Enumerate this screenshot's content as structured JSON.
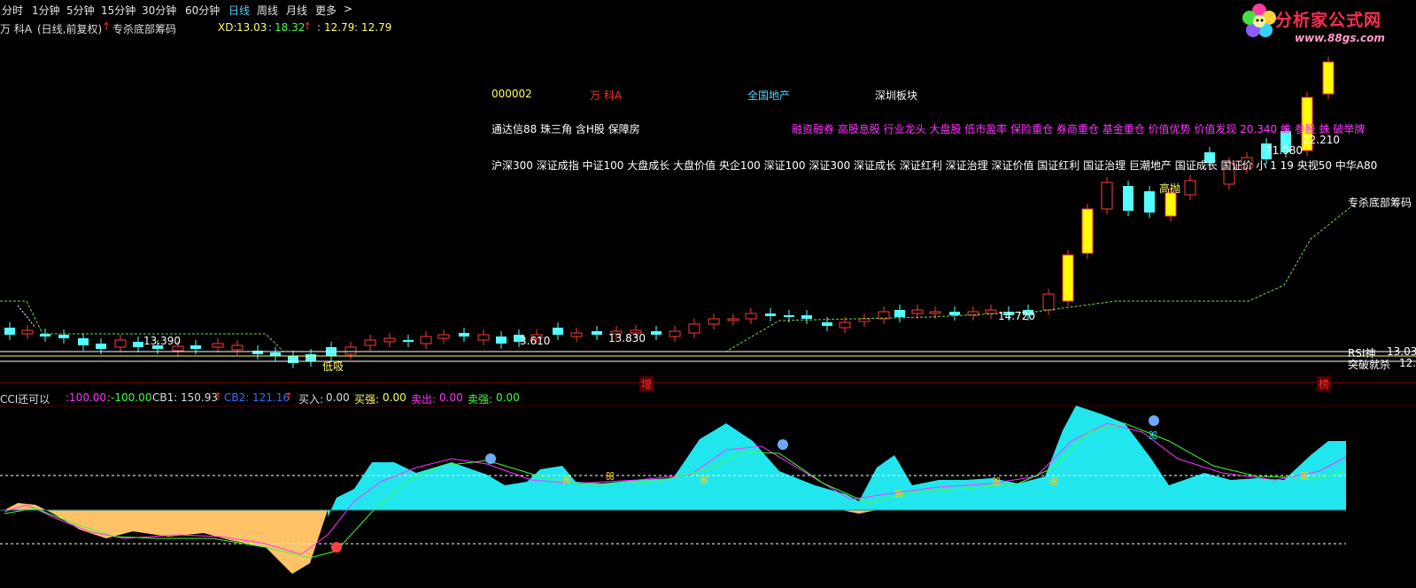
{
  "toolbar": {
    "tabs": [
      "分时",
      "1分钟",
      "5分钟",
      "15分钟",
      "30分钟",
      "60分钟",
      "日线",
      "周线",
      "月线",
      "更多"
    ],
    "active_tab": "日线",
    "more_arrow": ">"
  },
  "infobar": {
    "stock_name": "万  科A",
    "period": "(日线,前复权)",
    "formula": "专杀底部筹码",
    "xd_label": "XD:",
    "xd_v1": "13.03",
    "xd_v2": "18.32",
    "xd_v3": "12.79",
    "xd_v4": "12.79"
  },
  "logo": {
    "brand": "分析家公式网",
    "url": "www.88gs.com"
  },
  "overlay": {
    "code": "000002",
    "name": "万  科A",
    "sector": "全国地产",
    "region": "深圳板块",
    "concepts_a": "通达信88 珠三角 含H股 保障房",
    "concepts_b": "融资融券 高股息股 行业龙头 大盘股 低市盈率 保险重仓 券商重仓 基金重仓 价值优势 价值发现 20.340 蛛 参股 蛛 破举牌",
    "indices": "沪深300 深证成指 中证100 大盘成长 大盘价值 央企100 深证100 深证300 深证成长 深证红利 深证治理 深证价值 国证红利 国证治理 巨潮地产 国证成长 国证价 小 1 19 央视50 中华A80"
  },
  "price_labels": {
    "p1": "13.390",
    "p2": "3.610",
    "p3": "13.830",
    "p4": "14.720",
    "p5": "21.080",
    "p6": "22.210",
    "high_throw": "高抛",
    "low_buy": "低吸",
    "formula_tag": "专杀底部筹码",
    "rsi_label": "RSI神",
    "rsi_value": "13.03",
    "breakout_label": "突破就杀",
    "breakout_value": "12.",
    "bottom_tag1": "增",
    "bottom_tag2": "榜"
  },
  "indicator": {
    "name": "CCI还可以",
    "v1": ":100.00",
    "v2": ":-100.00",
    "cb1_label": "CB1:",
    "cb1": "150.93",
    "cb2_label": "CB2:",
    "cb2": "121.16",
    "buy_label": "买入:",
    "buy": "0.00",
    "buy_strong_label": "买强:",
    "buy_strong": "0.00",
    "sell_label": "卖出:",
    "sell": "0.00",
    "sell_strong_label": "卖强:",
    "sell_strong": "0.00"
  },
  "colors": {
    "bg": "#000000",
    "up_candle": "#ff3a3a",
    "down_candle": "#54ffff",
    "yellow_candle": "#ffff00",
    "cci_up": "#22e6ee",
    "cci_down": "#ffc266",
    "accent_blue": "#4fd2ff",
    "magenta": "#ff33ff"
  }
}
